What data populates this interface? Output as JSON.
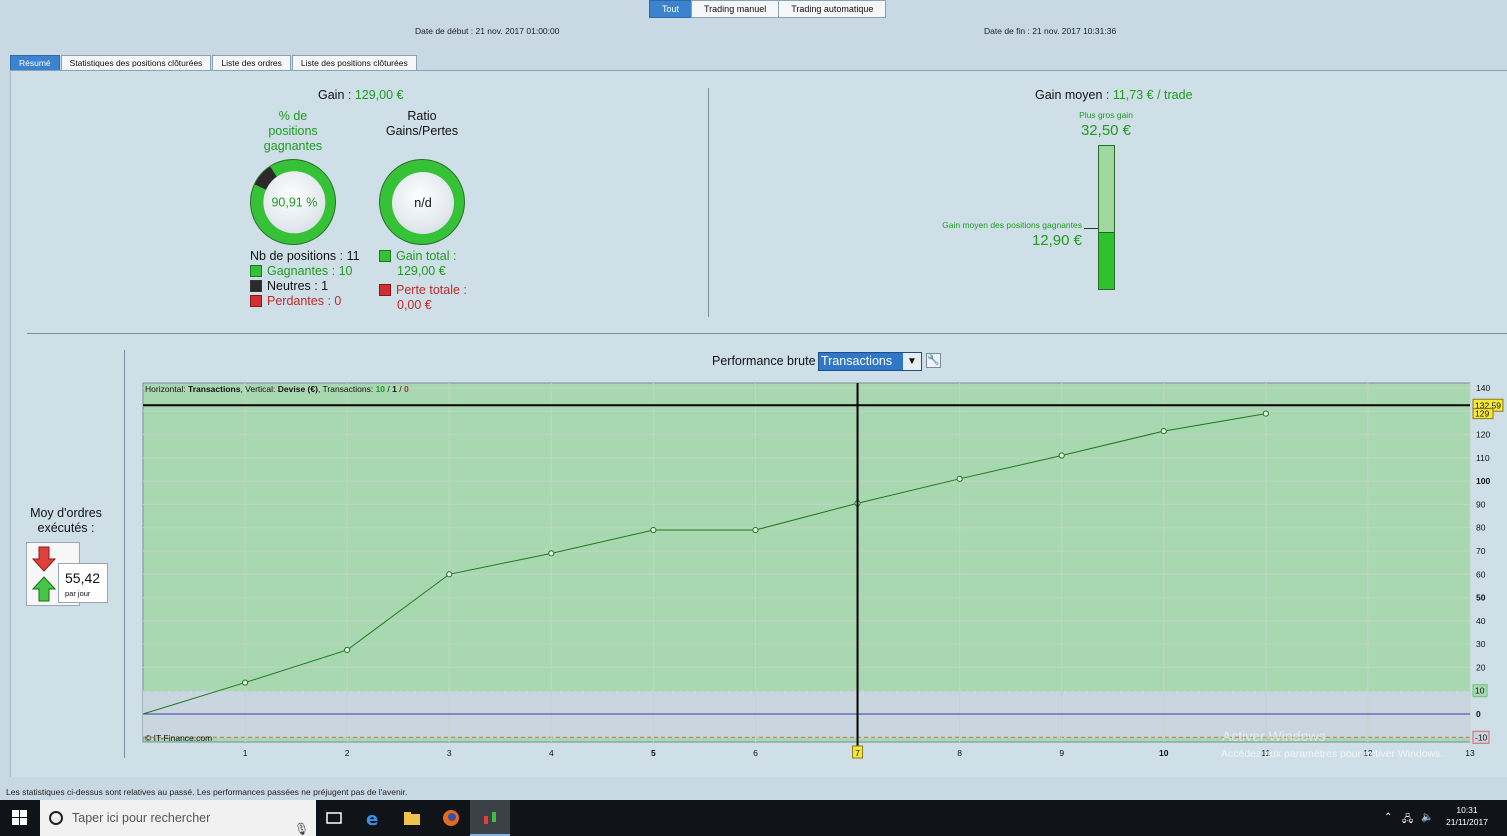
{
  "top_tabs": [
    {
      "label": "Tout",
      "active": true
    },
    {
      "label": "Trading manuel",
      "active": false
    },
    {
      "label": "Trading automatique",
      "active": false
    }
  ],
  "dates": {
    "start": "Date de début :  21 nov. 2017 01:00:00",
    "end": "Date de fin :  21 nov. 2017 10:31:36"
  },
  "tabs": [
    {
      "label": "Résumé",
      "active": true
    },
    {
      "label": "Statistiques des positions clôturées",
      "active": false
    },
    {
      "label": "Liste des ordres",
      "active": false
    },
    {
      "label": "Liste des positions clôturées",
      "active": false
    }
  ],
  "summary": {
    "gain_label": "Gain",
    "gain_value": "129,00 €",
    "pct_title_1": "% de",
    "pct_title_2": "positions",
    "pct_title_3": "gagnantes",
    "pct_value": "90,91 %",
    "pct_fraction": 0.9091,
    "ratio_title_1": "Ratio",
    "ratio_title_2": "Gains/Pertes",
    "ratio_value": "n/d",
    "nb_positions": "Nb de positions : 11",
    "gagnantes": "Gagnantes : 10",
    "neutres": "Neutres : 1",
    "perdantes": "Perdantes : 0",
    "gain_total_label": "Gain total :",
    "gain_total_value": "129,00 €",
    "perte_totale_label": "Perte totale :",
    "perte_totale_value": "0,00 €",
    "gain_moyen_label": "Gain moyen",
    "gain_moyen_value": "11,73 € / trade",
    "plus_gros_gain_label": "Plus gros gain",
    "plus_gros_gain_value": "32,50 €",
    "gain_moyen_positions_label": "Gain moyen des positions gagnantes",
    "gain_moyen_positions_value": "12,90 €",
    "bar_fill_fraction": 0.397
  },
  "orders": {
    "title_1": "Moy d'ordres",
    "title_2": "exécutés :",
    "value": "55,42",
    "unit": "par jour"
  },
  "performance": {
    "label": "Performance brute",
    "select_value": "Transactions",
    "info_prefix_h": "Horizontal: ",
    "info_h": "Transactions",
    "info_prefix_v": ", Vertical: ",
    "info_v": "Devise (€)",
    "info_prefix_t": ", Transactions: ",
    "info_t1": "10",
    "info_sep1": " / ",
    "info_t2": "1",
    "info_sep2": " / ",
    "info_t3": "0",
    "watermark": "© IT-Finance.com",
    "activate_1": "Activer Windows",
    "activate_2": "Accédez aux paramètres pour activer Windows."
  },
  "chart_data": {
    "type": "line",
    "x": [
      0,
      1,
      2,
      3,
      4,
      5,
      6,
      7,
      8,
      9,
      10,
      11
    ],
    "values": [
      0,
      13.5,
      27.5,
      60,
      69,
      79,
      79,
      90.5,
      101,
      111,
      121.5,
      129
    ],
    "xlim": [
      0,
      13
    ],
    "ylim": [
      -12,
      140
    ],
    "x_ticks": [
      "1",
      "2",
      "3",
      "4",
      "5",
      "6",
      "7",
      "8",
      "9",
      "10",
      "11",
      "12",
      "13"
    ],
    "y_ticks": [
      "140",
      "130",
      "120",
      "110",
      "100",
      "90",
      "80",
      "70",
      "60",
      "50",
      "40",
      "30",
      "20",
      "10",
      "0"
    ],
    "y_tick_values": [
      140,
      130,
      120,
      110,
      100,
      90,
      80,
      70,
      60,
      50,
      40,
      30,
      20,
      10,
      0
    ],
    "crosshair_x": 7,
    "crosshair_x_label": "7",
    "crosshair_y": 132.59,
    "crosshair_y_label": "132,59",
    "last_value_label": "129",
    "upper_band_label": "10",
    "lower_band_label": "-10",
    "upper_band": 10,
    "lower_band": -10,
    "colors": {
      "fill": "#a8d8b0",
      "line": "#1a7a1a",
      "band": "#c9d6df",
      "zero": "#3a3aa8"
    }
  },
  "footer": "Les statistiques ci-dessus sont relatives au passé. Les performances passées ne préjugent pas de l'avenir.",
  "taskbar": {
    "search_placeholder": "Taper ici pour rechercher",
    "time": "10:31",
    "date": "21/11/2017"
  }
}
